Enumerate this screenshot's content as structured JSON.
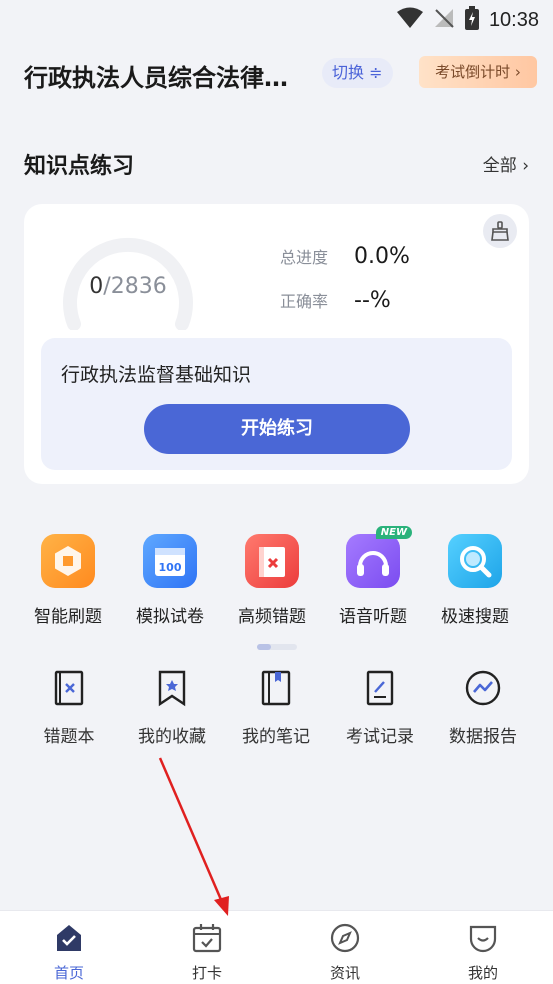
{
  "status_bar": {
    "time": "10:38"
  },
  "header": {
    "title": "行政执法人员综合法律…",
    "switch_label": "切换 ≑",
    "countdown_label": "考试倒计时 ›"
  },
  "section": {
    "title": "知识点练习",
    "all_label": "全部 ›"
  },
  "progress_card": {
    "done": "0",
    "total": "/2836",
    "total_progress_label": "总进度",
    "total_progress_value": "0.0%",
    "accuracy_label": "正确率",
    "accuracy_value": "--%",
    "chapter_title": "行政执法监督基础知识",
    "start_label": "开始练习"
  },
  "features": [
    {
      "label": "智能刷题",
      "icon": "smart-practice-icon",
      "color": "#ff9a2e"
    },
    {
      "label": "模拟试卷",
      "icon": "mock-exam-icon",
      "color": "#3f8cff",
      "badge_text": "100"
    },
    {
      "label": "高频错题",
      "icon": "frequent-mistakes-icon",
      "color": "#f25a57"
    },
    {
      "label": "语音听题",
      "icon": "audio-question-icon",
      "color": "#8b5cf6",
      "badge": "NEW"
    },
    {
      "label": "极速搜题",
      "icon": "quick-search-icon",
      "color": "#33b6f0"
    }
  ],
  "tools": [
    {
      "label": "错题本",
      "icon": "mistake-book-icon"
    },
    {
      "label": "我的收藏",
      "icon": "bookmark-icon"
    },
    {
      "label": "我的笔记",
      "icon": "notebook-icon"
    },
    {
      "label": "考试记录",
      "icon": "exam-record-icon"
    },
    {
      "label": "数据报告",
      "icon": "data-report-icon"
    }
  ],
  "tabbar": [
    {
      "label": "首页",
      "icon": "home-icon",
      "active": true
    },
    {
      "label": "打卡",
      "icon": "check-in-icon",
      "active": false
    },
    {
      "label": "资讯",
      "icon": "compass-icon",
      "active": false
    },
    {
      "label": "我的",
      "icon": "profile-icon",
      "active": false
    }
  ],
  "colors": {
    "accent": "#4a67d6",
    "annotation_arrow": "#e02020"
  }
}
